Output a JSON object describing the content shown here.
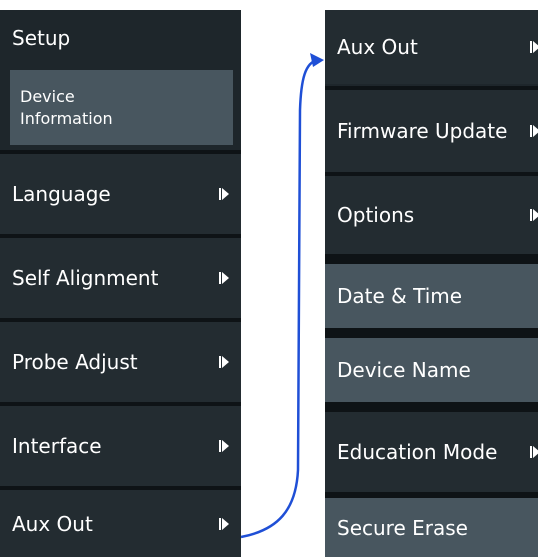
{
  "left_menu": {
    "title": "Setup",
    "items": [
      {
        "label_line1": "Device",
        "label_line2": "Information"
      },
      {
        "label": "Language",
        "icon": "submenu-arrow-icon"
      },
      {
        "label": "Self Alignment",
        "icon": "submenu-arrow-icon"
      },
      {
        "label": "Probe Adjust",
        "icon": "submenu-arrow-icon"
      },
      {
        "label": "Interface",
        "icon": "submenu-arrow-icon"
      },
      {
        "label": "Aux Out",
        "icon": "submenu-arrow-icon"
      }
    ]
  },
  "right_menu": {
    "items": [
      {
        "label": "Aux Out",
        "icon": "submenu-arrow-icon"
      },
      {
        "label": "Firmware Update",
        "icon": "submenu-arrow-icon"
      },
      {
        "label": "Options",
        "icon": "submenu-arrow-icon"
      },
      {
        "label": "Date & Time"
      },
      {
        "label": "Device Name"
      },
      {
        "label": "Education Mode",
        "icon": "submenu-arrow-icon"
      },
      {
        "label": "Secure Erase"
      }
    ]
  },
  "colors": {
    "panel_bg": "#1e262b",
    "item_dark": "#232c31",
    "item_light": "#48565f",
    "separator": "#0e1316",
    "connector": "#1f4fd6"
  },
  "connector_icon": "connector-arrow-icon"
}
